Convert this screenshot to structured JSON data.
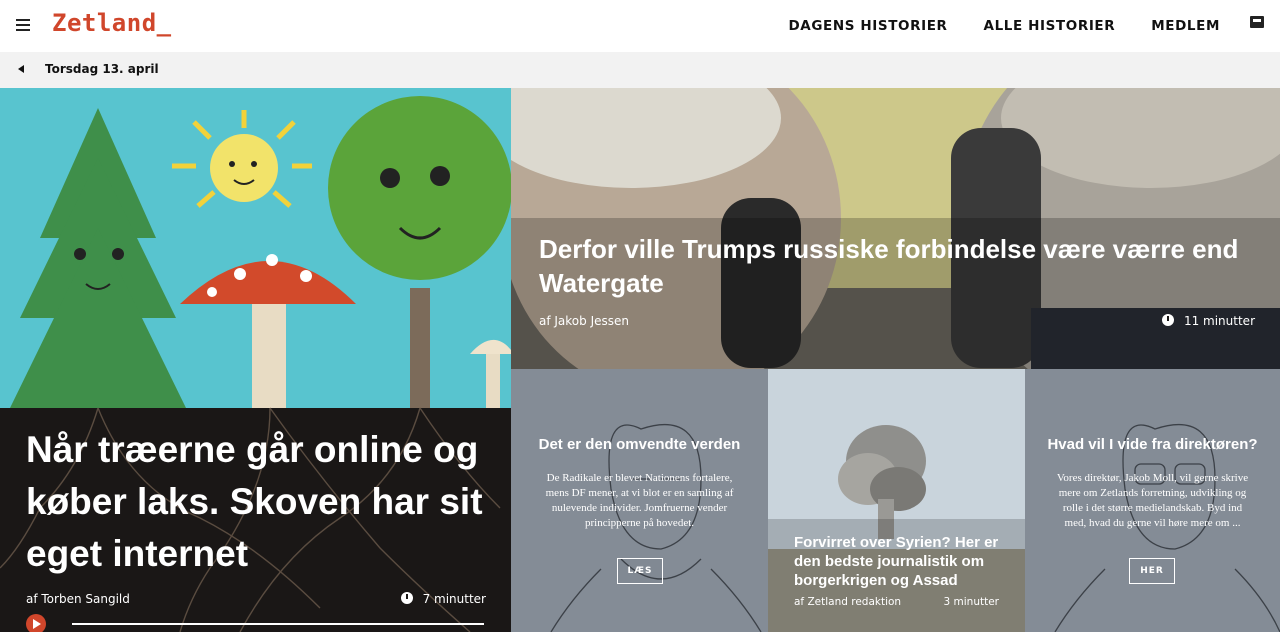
{
  "header": {
    "logo": "Zetland_",
    "nav": [
      "DAGENS HISTORIER",
      "ALLE HISTORIER",
      "MEDLEM"
    ]
  },
  "datebar": {
    "date": "Torsdag 13. april"
  },
  "hero": {
    "title": "Når træerne går online og køber laks. Skoven har sit eget internet",
    "author": "af Torben Sangild",
    "read_time": "7 minutter"
  },
  "feature": {
    "title": "Derfor ville Trumps russiske forbindelse være værre end Watergate",
    "author": "af Jakob Jessen",
    "read_time": "11 minutter"
  },
  "cards": [
    {
      "title": "Det er den omvendte verden",
      "text": "De Radikale er blevet Nationens fortalere, mens DF mener, at vi blot er en samling af nulevende individer. Jomfruerne vender principperne på hovedet.",
      "button": "LÆS"
    },
    {
      "title": "Forvirret over Syrien? Her er den bedste journalistik om borgerkrigen og Assad",
      "author": "af Zetland redaktion",
      "read_time": "3 minutter"
    },
    {
      "title": "Hvad vil I vide fra direktøren?",
      "text": "Vores direktør, Jakob Moll, vil gerne skrive mere om Zetlands forretning, udvikling og rolle i det større medielandskab. Byd ind med, hvad du gerne vil høre mere om ...",
      "button": "HER"
    }
  ],
  "colors": {
    "brand": "#d0462b",
    "card_grey": "#848c96",
    "hero_sky": "#58c4cf"
  }
}
